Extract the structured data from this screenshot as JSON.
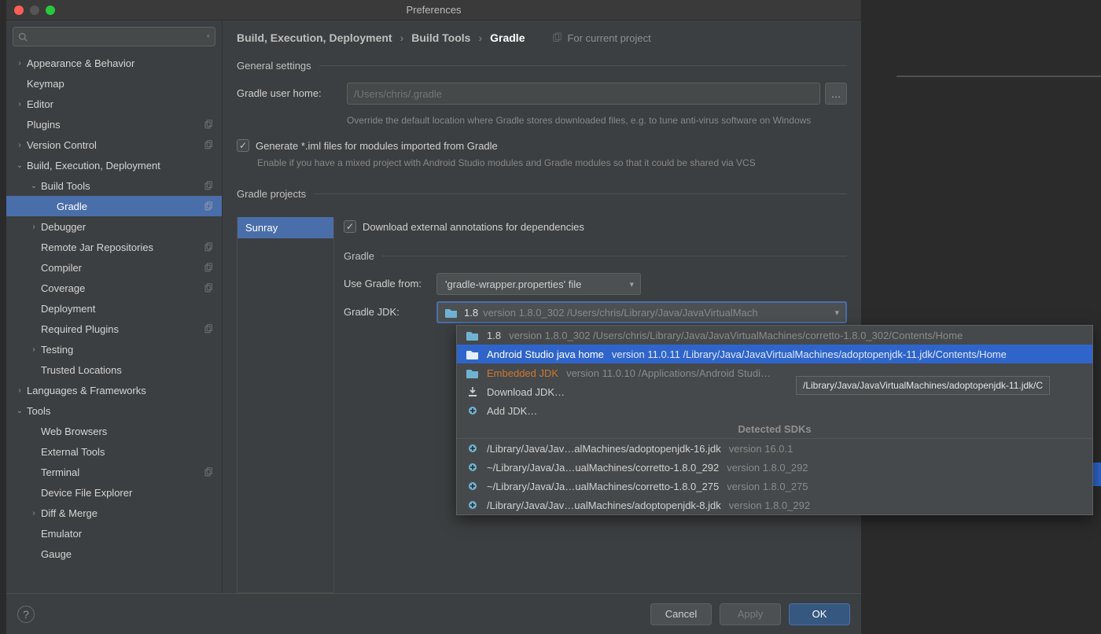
{
  "window": {
    "title": "Preferences"
  },
  "search": {
    "placeholder": ""
  },
  "sidebar": [
    {
      "arrow": "›",
      "label": "Appearance & Behavior",
      "indent": 0,
      "copy": false
    },
    {
      "arrow": "",
      "label": "Keymap",
      "indent": 0,
      "copy": false
    },
    {
      "arrow": "›",
      "label": "Editor",
      "indent": 0,
      "copy": false
    },
    {
      "arrow": "",
      "label": "Plugins",
      "indent": 0,
      "copy": true
    },
    {
      "arrow": "›",
      "label": "Version Control",
      "indent": 0,
      "copy": true
    },
    {
      "arrow": "⌄",
      "label": "Build, Execution, Deployment",
      "indent": 0,
      "copy": false
    },
    {
      "arrow": "⌄",
      "label": "Build Tools",
      "indent": 1,
      "copy": true
    },
    {
      "arrow": "",
      "label": "Gradle",
      "indent": 2,
      "selected": true,
      "copy": true
    },
    {
      "arrow": "›",
      "label": "Debugger",
      "indent": 1,
      "copy": false
    },
    {
      "arrow": "",
      "label": "Remote Jar Repositories",
      "indent": 1,
      "copy": true
    },
    {
      "arrow": "",
      "label": "Compiler",
      "indent": 1,
      "copy": true
    },
    {
      "arrow": "",
      "label": "Coverage",
      "indent": 1,
      "copy": true
    },
    {
      "arrow": "",
      "label": "Deployment",
      "indent": 1,
      "copy": false
    },
    {
      "arrow": "",
      "label": "Required Plugins",
      "indent": 1,
      "copy": true
    },
    {
      "arrow": "›",
      "label": "Testing",
      "indent": 1,
      "copy": false
    },
    {
      "arrow": "",
      "label": "Trusted Locations",
      "indent": 1,
      "copy": false
    },
    {
      "arrow": "›",
      "label": "Languages & Frameworks",
      "indent": 0,
      "copy": false
    },
    {
      "arrow": "⌄",
      "label": "Tools",
      "indent": 0,
      "copy": false
    },
    {
      "arrow": "",
      "label": "Web Browsers",
      "indent": 1,
      "copy": false
    },
    {
      "arrow": "",
      "label": "External Tools",
      "indent": 1,
      "copy": false
    },
    {
      "arrow": "",
      "label": "Terminal",
      "indent": 1,
      "copy": true
    },
    {
      "arrow": "",
      "label": "Device File Explorer",
      "indent": 1,
      "copy": false
    },
    {
      "arrow": "›",
      "label": "Diff & Merge",
      "indent": 1,
      "copy": false
    },
    {
      "arrow": "",
      "label": "Emulator",
      "indent": 1,
      "copy": false
    },
    {
      "arrow": "",
      "label": "Gauge",
      "indent": 1,
      "copy": false
    }
  ],
  "breadcrumb": {
    "items": [
      "Build, Execution, Deployment",
      "Build Tools",
      "Gradle"
    ],
    "for_project": "For current project"
  },
  "general": {
    "title": "General settings",
    "home_label": "Gradle user home:",
    "home_placeholder": "/Users/chris/.gradle",
    "home_hint": "Override the default location where Gradle stores downloaded files, e.g. to tune anti-virus software on Windows",
    "iml_label": "Generate *.iml files for modules imported from Gradle",
    "iml_hint": "Enable if you have a mixed project with Android Studio modules and Gradle modules so that it could be shared via VCS"
  },
  "projects": {
    "title": "Gradle projects",
    "project_name": "Sunray",
    "download_label": "Download external annotations for dependencies",
    "gradle_section": "Gradle",
    "use_from_label": "Use Gradle from:",
    "use_from_value": "'gradle-wrapper.properties' file",
    "jdk_label": "Gradle JDK:",
    "jdk_value_name": "1.8",
    "jdk_value_detail": "version 1.8.0_302 /Users/chris/Library/Java/JavaVirtualMach"
  },
  "dropdown": {
    "items": [
      {
        "name": "1.8",
        "detail": "version 1.8.0_302 /Users/chris/Library/Java/JavaVirtualMachines/corretto-1.8.0_302/Contents/Home",
        "icon": "folder"
      },
      {
        "name": "Android Studio java home",
        "detail": "version 11.0.11 /Library/Java/JavaVirtualMachines/adoptopenjdk-11.jdk/Contents/Home",
        "icon": "folder",
        "selected": true
      },
      {
        "name": "Embedded JDK",
        "detail": "version 11.0.10 /Applications/Android Studi…",
        "icon": "folder",
        "error": true
      },
      {
        "name": "Download JDK…",
        "detail": "",
        "icon": "download"
      },
      {
        "name": "Add JDK…",
        "detail": "",
        "icon": "add"
      }
    ],
    "header": "Detected SDKs",
    "detected": [
      {
        "path": "/Library/Java/Jav…alMachines/adoptopenjdk-16.jdk",
        "ver": "version 16.0.1"
      },
      {
        "path": "~/Library/Java/Ja…ualMachines/corretto-1.8.0_292",
        "ver": "version 1.8.0_292"
      },
      {
        "path": "~/Library/Java/Ja…ualMachines/corretto-1.8.0_275",
        "ver": "version 1.8.0_275"
      },
      {
        "path": "/Library/Java/Jav…ualMachines/adoptopenjdk-8.jdk",
        "ver": "version 1.8.0_292"
      }
    ]
  },
  "tooltip": "/Library/Java/JavaVirtualMachines/adoptopenjdk-11.jdk/C",
  "footer": {
    "cancel": "Cancel",
    "apply": "Apply",
    "ok": "OK"
  }
}
